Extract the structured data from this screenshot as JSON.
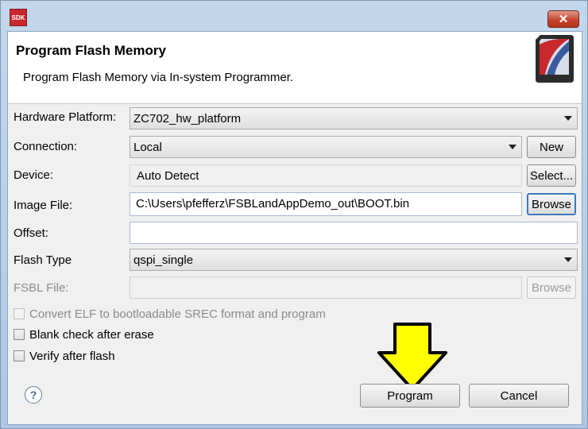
{
  "window": {
    "app_icon_text": "SDK",
    "close_glyph": "✕"
  },
  "header": {
    "title": "Program Flash Memory",
    "description": "Program Flash Memory via In-system Programmer."
  },
  "form": {
    "hardware_platform": {
      "label": "Hardware Platform:",
      "value": "ZC702_hw_platform"
    },
    "connection": {
      "label": "Connection:",
      "value": "Local",
      "new_button": "New"
    },
    "device": {
      "label": "Device:",
      "value": "Auto Detect",
      "select_button": "Select..."
    },
    "image_file": {
      "label": "Image File:",
      "value": "C:\\Users\\pfefferz\\FSBLandAppDemo_out\\BOOT.bin",
      "browse_button": "Browse"
    },
    "offset": {
      "label": "Offset:",
      "value": ""
    },
    "flash_type": {
      "label": "Flash Type",
      "value": "qspi_single"
    },
    "fsbl_file": {
      "label": "FSBL File:",
      "value": "",
      "browse_button": "Browse"
    }
  },
  "options": [
    {
      "label": "Convert ELF to bootloadable SREC format and program",
      "checked": false,
      "disabled": true
    },
    {
      "label": "Blank check after erase",
      "checked": false,
      "disabled": false
    },
    {
      "label": "Verify after flash",
      "checked": false,
      "disabled": false
    }
  ],
  "footer": {
    "help_glyph": "?",
    "program_button": "Program",
    "cancel_button": "Cancel"
  },
  "colors": {
    "annotation_arrow_fill": "#ffff00",
    "annotation_arrow_stroke": "#000000"
  }
}
